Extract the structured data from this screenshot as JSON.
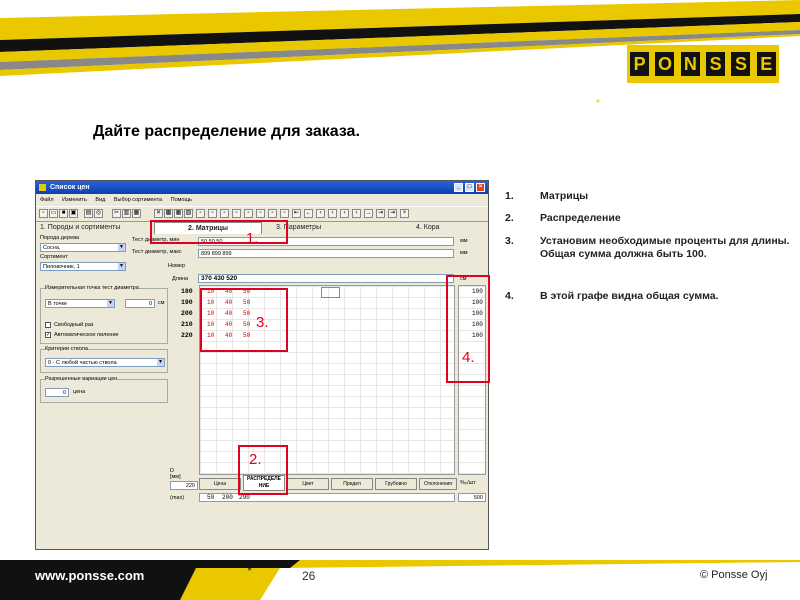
{
  "slide": {
    "title": "Дайте распределение для заказа.",
    "brand_letters": [
      "P",
      "O",
      "N",
      "S",
      "S",
      "E"
    ],
    "footer_url": "www.ponsse.com",
    "footer_page": "26",
    "footer_copyright": "© Ponsse Oyj",
    "star": "*",
    "colors": {
      "brand_yellow": "#e9c800",
      "highlight_red": "#e00020",
      "window_blue": "#0a3fb0"
    }
  },
  "window": {
    "title": "Список цен",
    "menu": [
      "Файл",
      "Изменить",
      "Вид",
      "Выбор сортимента",
      "Помощь"
    ],
    "tabs": [
      {
        "num": "1",
        "label": "Породы и сортименты"
      },
      {
        "num": "2",
        "label": "Матрицы"
      },
      {
        "num": "3",
        "label": "Параметры"
      },
      {
        "num": "4",
        "label": "Кора"
      }
    ],
    "left_panel": {
      "species_label": "Порода дерева",
      "species_value": "Сосна,",
      "assortment_label": "Сортимент",
      "assortment_value": "Пиловочник, 1",
      "measure_group_label": "Измерительная точка тест диаметра",
      "measure_value": "В точке",
      "measure_num": "0",
      "measure_unit": "см",
      "check_free": "Свободный раз",
      "check_auto": "Автоматическое пиление",
      "criteria_label": "Критерии ствола",
      "criteria_value": "0 - С любой частью ствола",
      "variation_label": "Разрешенные вариации цен",
      "variation_num": "0",
      "variation_unit": "цена",
      "d_label": "D [мм]",
      "d_value": "220",
      "max_label": "(max)"
    },
    "matrix": {
      "test_min_label": "Тест диаметр, мин",
      "test_max_label": "Тест диаметр, макс",
      "number_label": "Номер",
      "length_label": "Длина",
      "min_values": "50   50   50",
      "max_values": "899  899  899",
      "unit_mm": "мм",
      "unit_mm2": "мм",
      "unit_cm": "см",
      "lengths": "370  430  520",
      "diameters": [
        "180",
        "190",
        "200",
        "210",
        "220"
      ],
      "rows": [
        [
          "10",
          "40",
          "50"
        ],
        [
          "10",
          "40",
          "50"
        ],
        [
          "10",
          "40",
          "50"
        ],
        [
          "10",
          "40",
          "50"
        ],
        [
          "10",
          "40",
          "50"
        ]
      ],
      "sums": [
        "100",
        "100",
        "100",
        "100",
        "100"
      ],
      "bottom_buttons": [
        "Цена",
        "РАСПРЕДЕЛЕ НИЕ",
        "Цвет",
        "Предел",
        "Грубовно",
        "Отклонения"
      ],
      "pct_label": "%₀/шт",
      "bottom_values": [
        "50",
        "200",
        "290"
      ],
      "bottom_total": "500"
    },
    "markers": [
      "1.",
      "2.",
      "3.",
      "4."
    ]
  },
  "instructions": [
    {
      "num": "1.",
      "text": "Матрицы"
    },
    {
      "num": "2.",
      "text": "Распределение"
    },
    {
      "num": "3.",
      "text": "Установим необходимые проценты для длины. Общая сумма должна быть 100."
    },
    {
      "num": "4.",
      "text": "В этой графе видна общая сумма."
    }
  ]
}
